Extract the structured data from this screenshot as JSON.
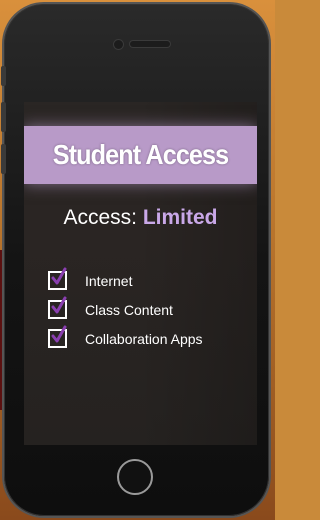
{
  "banner": {
    "title": "Student Access"
  },
  "access": {
    "label": "Access:",
    "value": "Limited"
  },
  "permissions": [
    {
      "label": "Internet",
      "checked": true
    },
    {
      "label": "Class Content",
      "checked": true
    },
    {
      "label": "Collaboration Apps",
      "checked": true
    }
  ],
  "colors": {
    "banner": "#b89ac8",
    "accent_value": "#c9a8e8",
    "checkmark": "#8a3fb0"
  }
}
